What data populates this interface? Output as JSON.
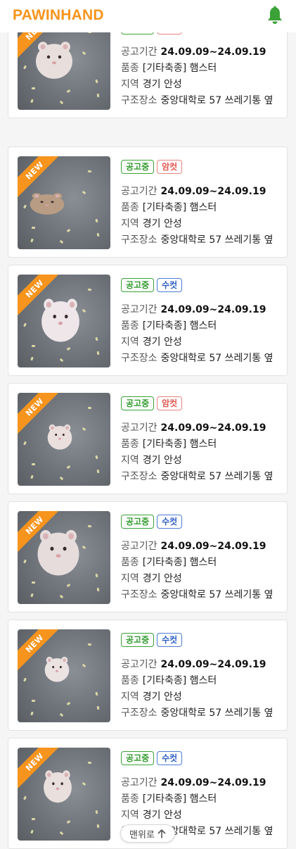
{
  "header": {
    "logo": "PAWINHAND",
    "bell_icon": "bell-icon",
    "accent": "#f7941d",
    "bell_color": "#3aa236"
  },
  "labels": {
    "period": "공고기간",
    "breed": "품종",
    "region": "지역",
    "rescue": "구조장소"
  },
  "new_ribbon": "NEW",
  "cards": [
    {
      "status": "공고중",
      "sex": "암컷",
      "sex_type": "female",
      "period": "24.09.09~24.09.19",
      "breed": "[기타축종] 햄스터",
      "region": "경기 안성",
      "rescue": "중앙대학로 57 쓰레기통 옆"
    },
    {
      "status": "공고중",
      "sex": "암컷",
      "sex_type": "female",
      "period": "24.09.09~24.09.19",
      "breed": "[기타축종] 햄스터",
      "region": "경기 안성",
      "rescue": "중앙대학로 57 쓰레기통 옆"
    },
    {
      "status": "공고중",
      "sex": "수컷",
      "sex_type": "male",
      "period": "24.09.09~24.09.19",
      "breed": "[기타축종] 햄스터",
      "region": "경기 안성",
      "rescue": "중앙대학로 57 쓰레기통 옆"
    },
    {
      "status": "공고중",
      "sex": "암컷",
      "sex_type": "female",
      "period": "24.09.09~24.09.19",
      "breed": "[기타축종] 햄스터",
      "region": "경기 안성",
      "rescue": "중앙대학로 57 쓰레기통 옆"
    },
    {
      "status": "공고중",
      "sex": "수컷",
      "sex_type": "male",
      "period": "24.09.09~24.09.19",
      "breed": "[기타축종] 햄스터",
      "region": "경기 안성",
      "rescue": "중앙대학로 57 쓰레기통 옆"
    },
    {
      "status": "공고중",
      "sex": "수컷",
      "sex_type": "male",
      "period": "24.09.09~24.09.19",
      "breed": "[기타축종] 햄스터",
      "region": "경기 안성",
      "rescue": "중앙대학로 57 쓰레기통 옆"
    },
    {
      "status": "공고중",
      "sex": "수컷",
      "sex_type": "male",
      "period": "24.09.09~24.09.19",
      "breed": "[기타축종] 햄스터",
      "region": "경기 안성",
      "rescue": "중앙대학로 57 쓰레기통 옆"
    }
  ],
  "scroll_top": {
    "label": "맨위로",
    "icon": "arrow-up-icon"
  }
}
